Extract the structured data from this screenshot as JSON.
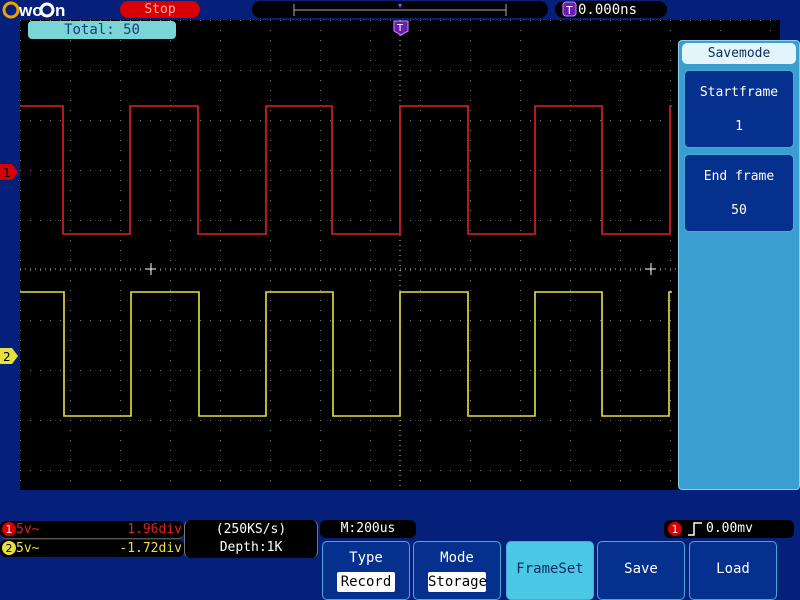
{
  "brand": {
    "name": "OWON"
  },
  "top": {
    "run_state": "Stop",
    "trigger_position_label": "0.000ns"
  },
  "grid": {
    "total_label": "Total: 50"
  },
  "channels": [
    {
      "id": "1",
      "coupling": "5v~",
      "offset": "1.96div",
      "color": "#e02020"
    },
    {
      "id": "2",
      "coupling": "5v~",
      "offset": "-1.72div",
      "color": "#e8e040"
    }
  ],
  "acquisition": {
    "sample_rate": "(250KS/s)",
    "depth": "Depth:1K"
  },
  "timebase": {
    "label": "M:200us"
  },
  "trigger": {
    "channel": "1",
    "level": "0.00mv",
    "slope": "rising"
  },
  "side_menu": {
    "title": "Savemode",
    "items": [
      {
        "label": "Startframe",
        "value": "1"
      },
      {
        "label": "End frame",
        "value": "50"
      }
    ]
  },
  "bottom_menu": [
    {
      "title": "Type",
      "value": "Record"
    },
    {
      "title": "Mode",
      "value": "Storage"
    },
    {
      "caption": "FrameSet",
      "active": true
    },
    {
      "caption": "Save"
    },
    {
      "caption": "Load"
    }
  ],
  "colors": {
    "ch1": "#e02020",
    "ch2": "#e8e040",
    "trigger_marker": "#b040ff",
    "accent": "#4bc8e6"
  }
}
